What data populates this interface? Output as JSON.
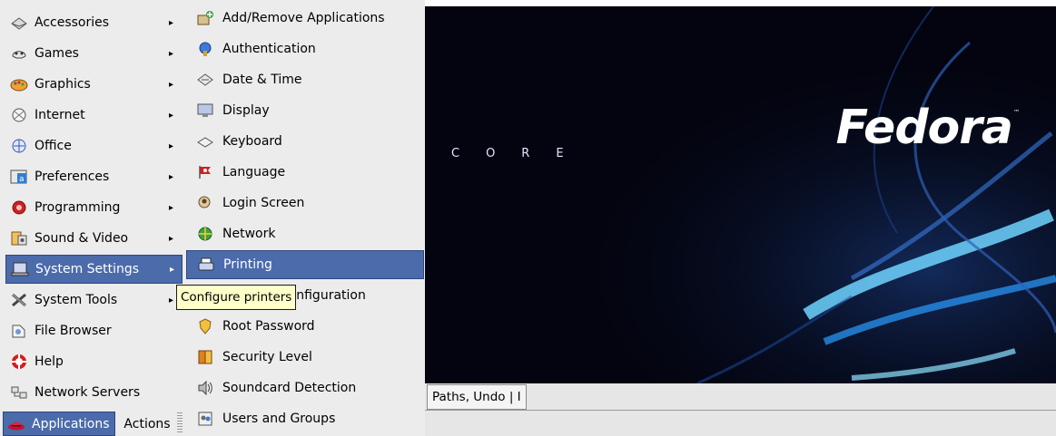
{
  "main_menu": {
    "items": [
      {
        "label": "Accessories",
        "icon": "accessories-icon",
        "submenu": true
      },
      {
        "label": "Games",
        "icon": "games-icon",
        "submenu": true
      },
      {
        "label": "Graphics",
        "icon": "graphics-icon",
        "submenu": true
      },
      {
        "label": "Internet",
        "icon": "internet-icon",
        "submenu": true
      },
      {
        "label": "Office",
        "icon": "office-icon",
        "submenu": true
      },
      {
        "label": "Preferences",
        "icon": "preferences-icon",
        "submenu": true
      },
      {
        "label": "Programming",
        "icon": "programming-icon",
        "submenu": true
      },
      {
        "label": "Sound & Video",
        "icon": "sound-video-icon",
        "submenu": true
      },
      {
        "label": "System Settings",
        "icon": "system-settings-icon",
        "submenu": true,
        "active": true
      },
      {
        "label": "System Tools",
        "icon": "system-tools-icon",
        "submenu": true
      },
      {
        "label": "File Browser",
        "icon": "file-browser-icon",
        "submenu": false
      },
      {
        "label": "Help",
        "icon": "help-icon",
        "submenu": false
      },
      {
        "label": "Network Servers",
        "icon": "network-servers-icon",
        "submenu": false
      }
    ]
  },
  "sub_menu": {
    "items": [
      {
        "label": "Add/Remove Applications",
        "icon": "add-remove-applications-icon"
      },
      {
        "label": "Authentication",
        "icon": "authentication-icon"
      },
      {
        "label": "Date & Time",
        "icon": "date-time-icon"
      },
      {
        "label": "Display",
        "icon": "display-icon"
      },
      {
        "label": "Keyboard",
        "icon": "keyboard-icon"
      },
      {
        "label": "Language",
        "icon": "language-icon"
      },
      {
        "label": "Login Screen",
        "icon": "login-screen-icon"
      },
      {
        "label": "Network",
        "icon": "network-icon"
      },
      {
        "label": "Printing",
        "icon": "printer-icon",
        "active": true
      },
      {
        "label": "Network Configuration",
        "icon": "network-configuration-icon"
      },
      {
        "label": "Root Password",
        "icon": "root-password-icon"
      },
      {
        "label": "Security Level",
        "icon": "security-level-icon"
      },
      {
        "label": "Soundcard Detection",
        "icon": "soundcard-icon"
      },
      {
        "label": "Users and Groups",
        "icon": "users-groups-icon"
      }
    ]
  },
  "tooltip": {
    "text": "Configure printers"
  },
  "panel": {
    "applications_label": "Applications",
    "actions_label": "Actions"
  },
  "taskbar": {
    "button_label": "Paths, Undo | I"
  },
  "desktop": {
    "logo_text": "Fedora",
    "logo_tm": "™",
    "logo_sub": "CORE"
  },
  "colors": {
    "highlight": "#4b6bab",
    "menu_bg": "#ececec",
    "tooltip_bg": "#ffffc8",
    "desktop_bg": "#03040f"
  }
}
